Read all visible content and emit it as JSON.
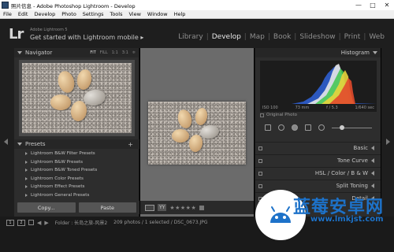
{
  "window": {
    "title": "照片信息 - Adobe Photoshop Lightroom - Develop",
    "controls": {
      "minimize": "—",
      "maximize": "□",
      "close": "✕"
    }
  },
  "menu": [
    "File",
    "Edit",
    "Develop",
    "Photo",
    "Settings",
    "Tools",
    "View",
    "Window",
    "Help"
  ],
  "identity": {
    "logo": "Lr",
    "brand": "Adobe Lightroom 5",
    "tagline": "Get started with Lightroom mobile ▸"
  },
  "modules": [
    {
      "label": "Library",
      "active": false
    },
    {
      "label": "Develop",
      "active": true
    },
    {
      "label": "Map",
      "active": false
    },
    {
      "label": "Book",
      "active": false
    },
    {
      "label": "Slideshow",
      "active": false
    },
    {
      "label": "Print",
      "active": false
    },
    {
      "label": "Web",
      "active": false
    }
  ],
  "navigator": {
    "title": "Navigator",
    "zoom_options": [
      "FIT",
      "FILL",
      "1:1",
      "3:1",
      "≑"
    ],
    "active_zoom": "FIT"
  },
  "presets": {
    "title": "Presets",
    "add_label": "+",
    "items": [
      "Lightroom B&W Filter Presets",
      "Lightroom B&W Presets",
      "Lightroom B&W Toned Presets",
      "Lightroom Color Presets",
      "Lightroom Effect Presets",
      "Lightroom General Presets"
    ]
  },
  "left_buttons": {
    "copy": "Copy...",
    "paste": "Paste"
  },
  "histogram": {
    "title": "Histogram",
    "info": [
      "ISO 100",
      "73 mm",
      "f / 5.3",
      "1/640 sec"
    ],
    "original_photo": "Original Photo"
  },
  "right_sections": [
    {
      "label": "Basic",
      "dim_parts": []
    },
    {
      "label": "Tone Curve",
      "dim_parts": []
    },
    {
      "label": "HSL / Color / B & W",
      "dim_parts": []
    },
    {
      "label": "Split Toning",
      "dim_parts": []
    },
    {
      "label": "Detail",
      "dim_parts": []
    }
  ],
  "toolbar": {
    "view_toggle": "YY",
    "stars": "★★★★★"
  },
  "filmbar": {
    "page1": "1",
    "page2": "2",
    "folder_text": "Folder : 长岛之旅-风景2",
    "count_text": "209 photos / 1 selected / DSC_0673.JPG"
  },
  "watermark": {
    "name": "蓝莓安卓网",
    "url": "www.lmkjst.com"
  },
  "colors": {
    "accent_blue": "#1d72c9",
    "panel": "#2d2d2d",
    "canvas": "#6b6b6b"
  }
}
